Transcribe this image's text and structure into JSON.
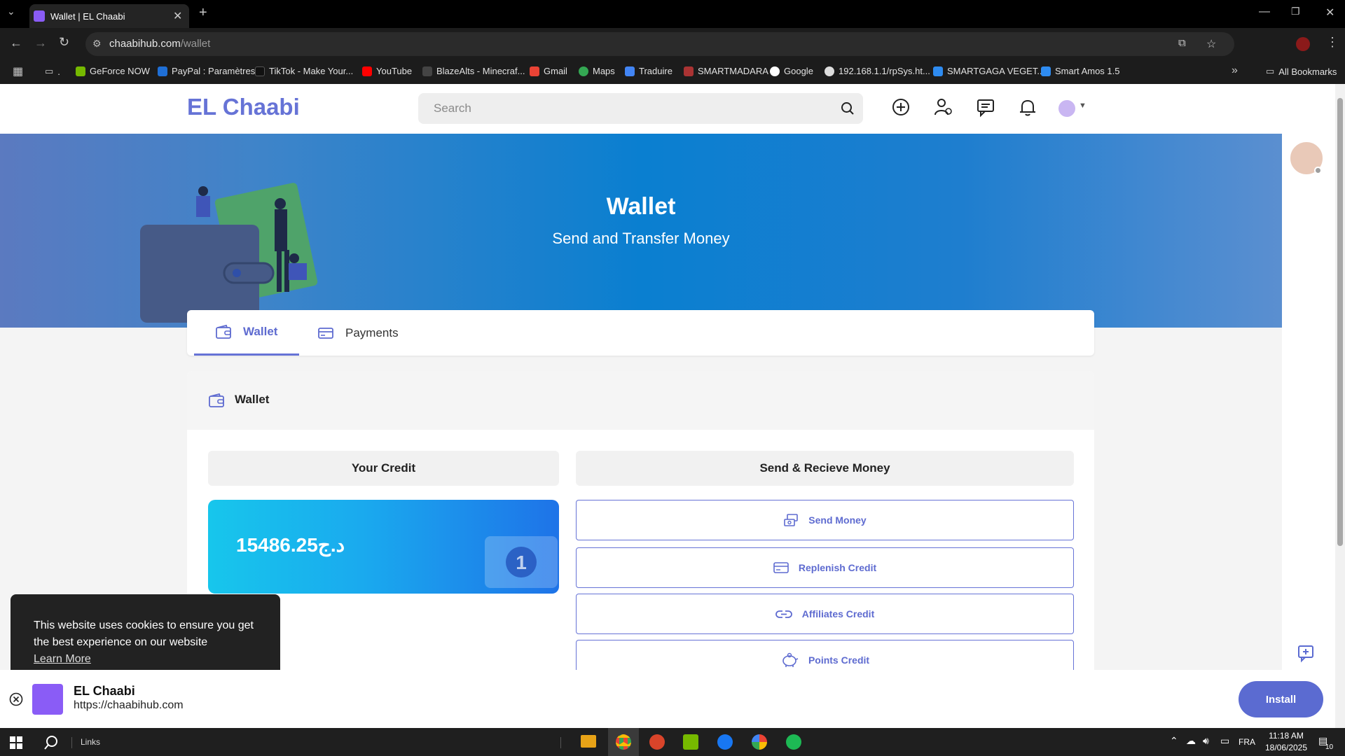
{
  "browser": {
    "tab_title": "Wallet | EL Chaabi",
    "url_domain": "chaabihub.com",
    "url_path": "/wallet",
    "bookmarks": [
      "GeForce NOW",
      "PayPal : Paramètres",
      "TikTok - Make Your...",
      "YouTube",
      "BlazeAlts - Minecraf...",
      "Gmail",
      "Maps",
      "Traduire",
      "SMARTMADARA",
      "Google",
      "192.168.1.1/rpSys.ht...",
      "SMARTGAGA VEGET...",
      "Smart Amos 1.5"
    ],
    "all_bookmarks": "All Bookmarks",
    "folder_dot": "."
  },
  "site": {
    "brand": "EL Chaabi",
    "search_placeholder": "Search"
  },
  "hero": {
    "title": "Wallet",
    "subtitle": "Send and Transfer Money"
  },
  "tabs": {
    "wallet": "Wallet",
    "payments": "Payments"
  },
  "wallet_section": {
    "title": "Wallet",
    "your_credit_label": "Your Credit",
    "credit_value": "15486.25د.ج",
    "send_receive_label": "Send & Recieve Money",
    "actions": [
      "Send Money",
      "Replenish Credit",
      "Affiliates Credit",
      "Points Credit"
    ]
  },
  "cookie": {
    "message": "This website uses cookies to ensure you get the best experience on our website",
    "learn_more": "Learn More"
  },
  "install": {
    "name": "EL Chaabi",
    "url": "https://chaabihub.com",
    "button": "Install"
  },
  "taskbar": {
    "links": "Links",
    "language": "FRA",
    "time": "11:18 AM",
    "date": "18/06/2025",
    "notifications": "10"
  },
  "colors": {
    "brand": "#6673d6",
    "hero_blue": "#0a7fd0",
    "install": "#5b6bd1"
  }
}
